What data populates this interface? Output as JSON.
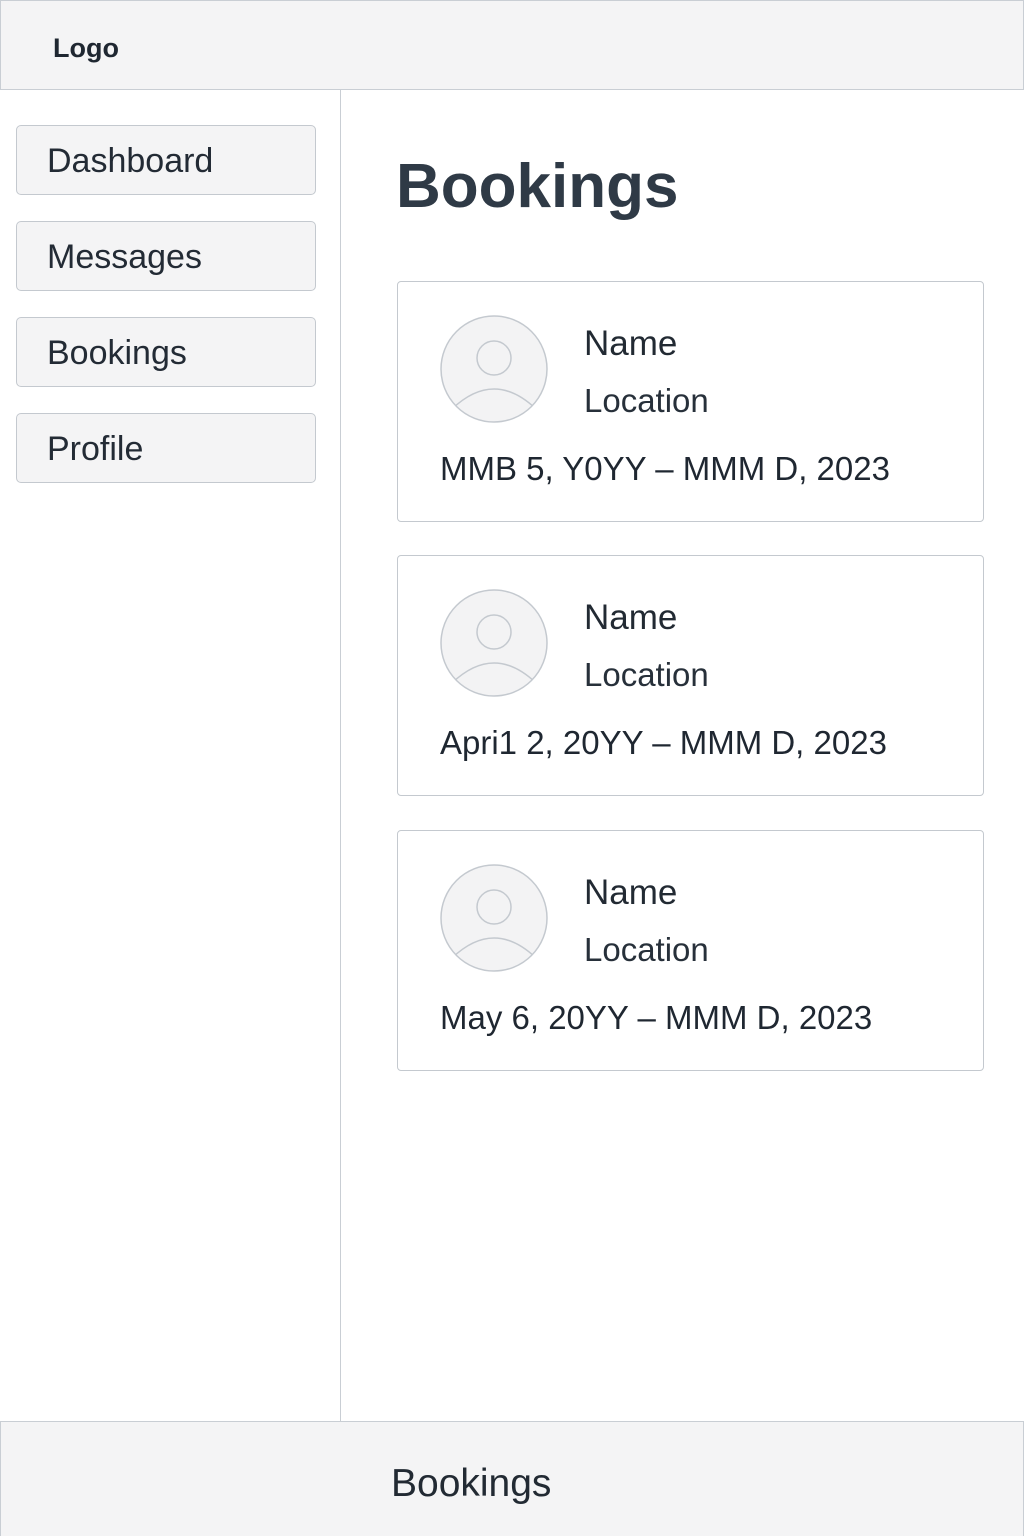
{
  "header": {
    "logo": "Logo"
  },
  "sidebar": {
    "items": [
      {
        "label": "Dashboard"
      },
      {
        "label": "Messages"
      },
      {
        "label": "Bookings"
      },
      {
        "label": "Profile"
      }
    ]
  },
  "main": {
    "title": "Bookings",
    "bookings": [
      {
        "name": "Name",
        "location": "Location",
        "dates": "MMB 5, Y0YY – MMM D, 2023",
        "avatar_icon": "user-avatar-icon"
      },
      {
        "name": "Name",
        "location": "Location",
        "dates": "Apri1 2, 20YY – MMM D, 2023",
        "avatar_icon": "user-avatar-icon"
      },
      {
        "name": "Name",
        "location": "Location",
        "dates": "May 6, 20YY – MMM D, 2023",
        "avatar_icon": "user-avatar-icon"
      }
    ]
  },
  "footer": {
    "label": "Bookings"
  },
  "colors": {
    "panel_background": "#f4f4f5",
    "border": "#c9ced4",
    "title_text": "#2f3a46"
  }
}
